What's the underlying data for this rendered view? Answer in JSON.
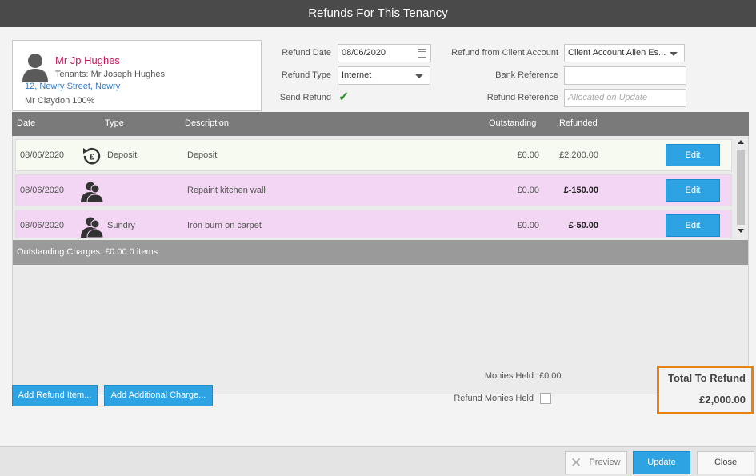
{
  "window": {
    "title": "Refunds For This Tenancy"
  },
  "tenant": {
    "name": "Mr Jp Hughes",
    "tenants": "Tenants: Mr Joseph Hughes",
    "address": "12, Newry Street, Newry",
    "landlord": "Mr Claydon 100%",
    "avatar_icon": "person-icon"
  },
  "form": {
    "refund_date_label": "Refund Date",
    "refund_date": "08/06/2020",
    "refund_type_label": "Refund Type",
    "refund_type": "Internet",
    "send_refund_label": "Send Refund",
    "send_refund_checked": true,
    "refund_from_label": "Refund from Client Account",
    "refund_from": "Client Account Allen Es...",
    "bank_reference_label": "Bank Reference",
    "bank_reference": "",
    "refund_reference_label": "Refund Reference",
    "refund_reference_placeholder": "Allocated on Update"
  },
  "grid": {
    "columns": [
      "Date",
      "Type",
      "Description",
      "Outstanding",
      "Refunded"
    ],
    "rows": [
      {
        "date": "08/06/2020",
        "icon": "deposit-refund-icon",
        "type": "Deposit",
        "description": "Deposit",
        "outstanding": "£0.00",
        "refunded": "£2,200.00",
        "edit": "Edit",
        "bg": "#f6faf0"
      },
      {
        "date": "08/06/2020",
        "icon": "person-icon",
        "type": "",
        "description": "Repaint kitchen wall",
        "outstanding": "£0.00",
        "refunded": "£-150.00",
        "edit": "Edit",
        "bg": "#f3d6f3"
      },
      {
        "date": "08/06/2020",
        "icon": "person-icon",
        "type": "Sundry",
        "description": "Iron burn on carpet",
        "outstanding": "£0.00",
        "refunded": "£-50.00",
        "edit": "Edit",
        "bg": "#f3d6f3"
      }
    ],
    "outstanding_charges": "Outstanding Charges: £0.00 0 items"
  },
  "actions": {
    "add_refund_item": "Add Refund Item...",
    "add_additional_charge": "Add Additional Charge..."
  },
  "monies": {
    "held_label": "Monies Held",
    "held_value": "£0.00",
    "refund_held_label": "Refund Monies Held",
    "refund_held_checked": false
  },
  "total": {
    "label": "Total To Refund",
    "value": "£2,000.00"
  },
  "footer": {
    "preview": "Preview",
    "update": "Update",
    "close": "Close"
  },
  "colors": {
    "accent": "#2ea3e3",
    "highlight": "#e8820c",
    "tenant_name": "#c2185b",
    "link": "#3a7bbf"
  }
}
